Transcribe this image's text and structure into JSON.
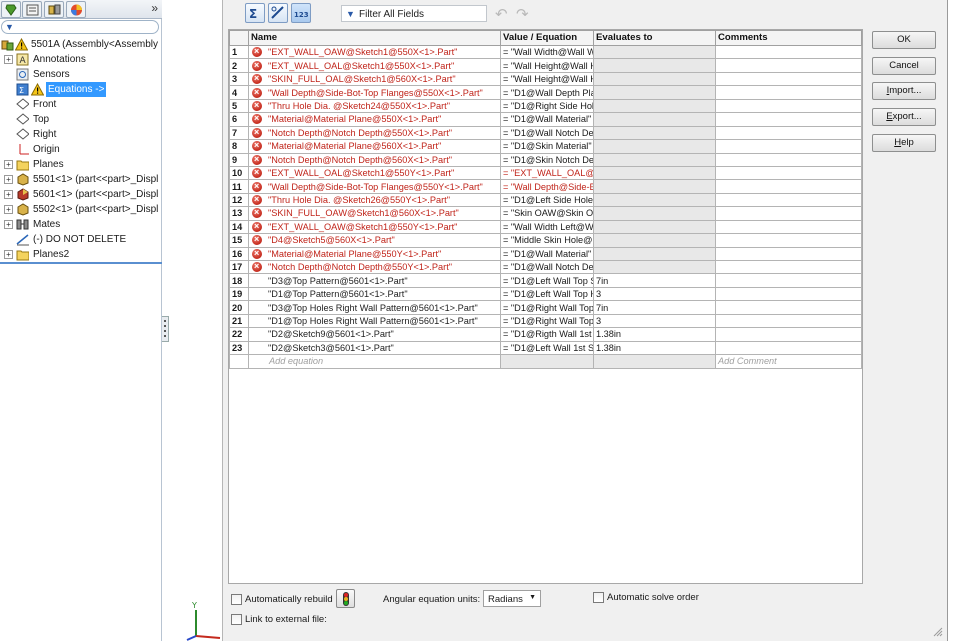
{
  "tree": {
    "collapse_glyph": "»",
    "filter_glyph": "▼",
    "items": [
      {
        "label": "5501A  (Assembly<Assembly",
        "icon": "assembly-warning-icon"
      },
      {
        "label": "Annotations",
        "icon": "annotations-icon"
      },
      {
        "label": "Sensors",
        "icon": "sensors-icon"
      },
      {
        "label": "Equations ->",
        "icon": "equations-icon"
      },
      {
        "label": "Front",
        "icon": "plane-icon"
      },
      {
        "label": "Top",
        "icon": "plane-icon"
      },
      {
        "label": "Right",
        "icon": "plane-icon"
      },
      {
        "label": "Origin",
        "icon": "origin-icon"
      },
      {
        "label": "Planes",
        "icon": "folder-icon"
      },
      {
        "label": "5501<1> (part<<part>_Displ",
        "icon": "part-icon"
      },
      {
        "label": "5601<1> (part<<part>_Displ",
        "icon": "part-icon"
      },
      {
        "label": "5502<1> (part<<part>_Displ",
        "icon": "part-icon"
      },
      {
        "label": "Mates",
        "icon": "mates-icon"
      },
      {
        "label": "(-) DO NOT DELETE",
        "icon": "sketch-icon"
      },
      {
        "label": "Planes2",
        "icon": "folder-icon"
      }
    ]
  },
  "toolbar": {
    "filter_placeholder": "Filter All Fields",
    "undo_glyph": "↶",
    "redo_glyph": "↷"
  },
  "table": {
    "headers": [
      "Name",
      "Value / Equation",
      "Evaluates to",
      "Comments"
    ],
    "rows": [
      {
        "n": "1",
        "err": true,
        "name": "\"EXT_WALL_OAW@Sketch1@550X<1>.Part\"",
        "value": "= \"Wall Width@Wall W",
        "eval": "",
        "comment": ""
      },
      {
        "n": "2",
        "err": true,
        "name": "\"EXT_WALL_OAL@Sketch1@550X<1>.Part\"",
        "value": "= \"Wall Height@Wall H",
        "eval": "",
        "comment": ""
      },
      {
        "n": "3",
        "err": true,
        "name": "\"SKIN_FULL_OAL@Sketch1@560X<1>.Part\"",
        "value": "= \"Wall Height@Wall H",
        "eval": "",
        "comment": ""
      },
      {
        "n": "4",
        "err": true,
        "name": "\"Wall Depth@Side-Bot-Top Flanges@550X<1>.Part\"",
        "value": "= \"D1@Wall Depth Pla",
        "eval": "",
        "comment": ""
      },
      {
        "n": "5",
        "err": true,
        "name": "\"Thru Hole Dia. @Sketch24@550X<1>.Part\"",
        "value": "= \"D1@Right Side Hole",
        "eval": "",
        "comment": ""
      },
      {
        "n": "6",
        "err": true,
        "name": "\"Material@Material Plane@550X<1>.Part\"",
        "value": "= \"D1@Wall Material\"",
        "eval": "",
        "comment": ""
      },
      {
        "n": "7",
        "err": true,
        "name": "\"Notch Depth@Notch Depth@550X<1>.Part\"",
        "value": "= \"D1@Wall Notch Dep",
        "eval": "",
        "comment": ""
      },
      {
        "n": "8",
        "err": true,
        "name": "\"Material@Material Plane@560X<1>.Part\"",
        "value": "= \"D1@Skin Material\"",
        "eval": "",
        "comment": ""
      },
      {
        "n": "9",
        "err": true,
        "name": "\"Notch Depth@Notch Depth@560X<1>.Part\"",
        "value": "= \"D1@Skin Notch Dep",
        "eval": "",
        "comment": ""
      },
      {
        "n": "10",
        "err": true,
        "name": "\"EXT_WALL_OAL@Sketch1@550Y<1>.Part\"",
        "value": "= \"EXT_WALL_OAL@S",
        "value_red": true,
        "eval": "",
        "comment": ""
      },
      {
        "n": "11",
        "err": true,
        "name": "\"Wall Depth@Side-Bot-Top Flanges@550Y<1>.Part\"",
        "value": "= \"Wall Depth@Side-B",
        "value_red": true,
        "eval": "",
        "comment": ""
      },
      {
        "n": "12",
        "err": true,
        "name": "\"Thru Hole Dia. @Sketch26@550Y<1>.Part\"",
        "value": "= \"D1@Left Side Hole",
        "eval": "",
        "comment": ""
      },
      {
        "n": "13",
        "err": true,
        "name": "\"SKIN_FULL_OAW@Sketch1@560X<1>.Part\"",
        "value": "= \"Skin OAW@Skin OA",
        "eval": "",
        "comment": ""
      },
      {
        "n": "14",
        "err": true,
        "name": "\"EXT_WALL_OAW@Sketch1@550Y<1>.Part\"",
        "value": "= \"Wall Width Left@W",
        "eval": "",
        "comment": ""
      },
      {
        "n": "15",
        "err": true,
        "name": "\"D4@Sketch5@560X<1>.Part\"",
        "value": "= \"Middle Skin Hole@M",
        "eval": "",
        "comment": ""
      },
      {
        "n": "16",
        "err": true,
        "name": "\"Material@Material Plane@550Y<1>.Part\"",
        "value": "= \"D1@Wall Material\"",
        "eval": "",
        "comment": ""
      },
      {
        "n": "17",
        "err": true,
        "name": "\"Notch Depth@Notch Depth@550Y<1>.Part\"",
        "value": "= \"D1@Wall Notch Dep",
        "eval": "",
        "comment": ""
      },
      {
        "n": "18",
        "err": false,
        "name": "\"D3@Top Pattern@5601<1>.Part\"",
        "value": "= \"D1@Left Wall Top S",
        "eval": "7in",
        "comment": ""
      },
      {
        "n": "19",
        "err": false,
        "name": "\"D1@Top Pattern@5601<1>.Part\"",
        "value": "= \"D1@Left Wall Top H",
        "eval": "3",
        "comment": ""
      },
      {
        "n": "20",
        "err": false,
        "name": "\"D3@Top Holes Right Wall Pattern@5601<1>.Part\"",
        "value": "= \"D1@Right Wall Top",
        "eval": "7in",
        "comment": ""
      },
      {
        "n": "21",
        "err": false,
        "name": "\"D1@Top Holes Right Wall Pattern@5601<1>.Part\"",
        "value": "= \"D1@Right Wall Top",
        "eval": "3",
        "comment": ""
      },
      {
        "n": "22",
        "err": false,
        "name": "\"D2@Sketch9@5601<1>.Part\"",
        "value": "= \"D1@Rigth Wall 1st",
        "eval": "1.38in",
        "comment": ""
      },
      {
        "n": "23",
        "err": false,
        "name": "\"D2@Sketch3@5601<1>.Part\"",
        "value": "= \"D1@Left Wall 1st S",
        "eval": "1.38in",
        "comment": ""
      }
    ],
    "add_equation_placeholder": "Add equation",
    "add_comment_placeholder": "Add Comment"
  },
  "options": {
    "auto_rebuild_label": "Automatically rebuild",
    "auto_rebuild_checked": false,
    "angular_units_label": "Angular equation units:",
    "angular_units_value": "Radians",
    "auto_solve_label": "Automatic solve order",
    "auto_solve_checked": false,
    "link_external_label": "Link to external file:",
    "link_external_checked": false
  },
  "buttons": {
    "ok": "OK",
    "cancel": "Cancel",
    "import_prefix": "I",
    "import_rest": "mport...",
    "export_prefix": "E",
    "export_rest": "xport...",
    "help_prefix": "H",
    "help_rest": "elp"
  },
  "colors": {
    "error_text": "#c0241a",
    "selection": "#3399ff",
    "eval_cell_bg": "#e8e8e8"
  }
}
